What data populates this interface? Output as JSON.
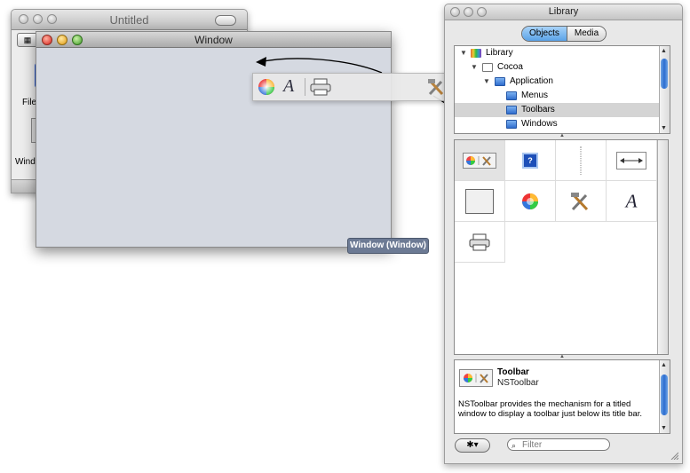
{
  "untitled_window": {
    "title": "Untitled",
    "label_file": "File",
    "label_window": "Wind"
  },
  "main_window": {
    "title": "Window",
    "tooltip": "Window (Window)"
  },
  "library": {
    "title": "Library",
    "segments": [
      "Objects",
      "Media"
    ],
    "tree": [
      {
        "label": "Library",
        "depth": 0,
        "expanded": true,
        "icon": "library-icon"
      },
      {
        "label": "Cocoa",
        "depth": 1,
        "expanded": true,
        "icon": "folder-icon"
      },
      {
        "label": "Application",
        "depth": 2,
        "expanded": true,
        "icon": "folder-icon"
      },
      {
        "label": "Menus",
        "depth": 3,
        "icon": "folder-icon"
      },
      {
        "label": "Toolbars",
        "depth": 3,
        "selected": true,
        "icon": "folder-icon"
      },
      {
        "label": "Windows",
        "depth": 3,
        "icon": "folder-icon"
      }
    ],
    "grid_items": [
      "toolbar",
      "help-toolbar-item",
      "separator-toolbar-item",
      "space-toolbar-item",
      "flexible-box",
      "colors-toolbar-item",
      "customize-toolbar-item",
      "fonts-toolbar-item",
      "print-toolbar-item"
    ],
    "info": {
      "title": "Toolbar",
      "class_name": "NSToolbar",
      "description": "NSToolbar provides the mechanism for a titled window to display a toolbar just below its title bar."
    },
    "filter_placeholder": "Filter"
  },
  "colors": {
    "selection": "#d4d4d4",
    "window_body": "#d5d9e1",
    "tooltip_bg": "#6c7a94",
    "scroll_thumb": "#2b6cd0"
  }
}
